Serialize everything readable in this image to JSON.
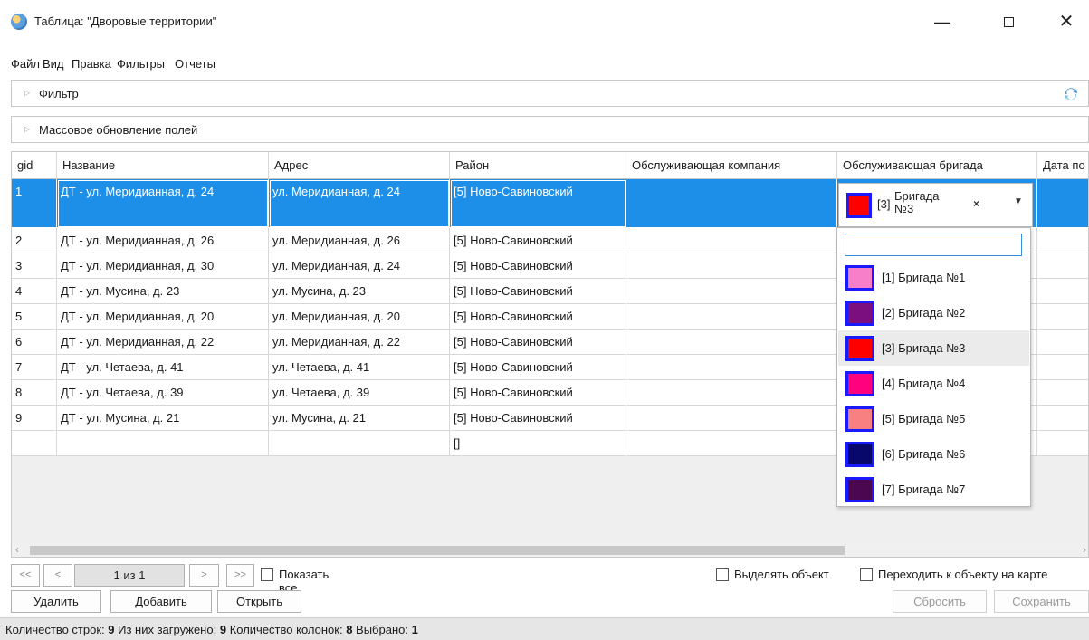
{
  "window": {
    "title": "Таблица: \"Дворовые территории\"",
    "minimize_glyph": "—",
    "close_glyph": "✕"
  },
  "menu": [
    "Файл",
    "Вид",
    "Правка",
    "Фильтры",
    "Отчеты"
  ],
  "panels": {
    "filter_label": "Фильтр",
    "mass_update_label": "Массовое обновление полей"
  },
  "grid": {
    "columns": [
      "gid",
      "Название",
      "Адрес",
      "Район",
      "Обслуживающая компания",
      "Обслуживающая бригада",
      "Дата по"
    ],
    "rows": [
      {
        "gid": "1",
        "name": "ДТ - ул. Меридианная, д. 24",
        "address": "ул. Меридианная, д. 24",
        "district": "[5]  Ново-Савиновский",
        "selected": true
      },
      {
        "gid": "2",
        "name": "ДТ - ул. Меридианная, д. 26",
        "address": "ул. Меридианная, д. 26",
        "district": "[5]  Ново-Савиновский"
      },
      {
        "gid": "3",
        "name": "ДТ - ул. Меридианная, д. 30",
        "address": "ул. Меридианная, д. 24",
        "district": "[5]  Ново-Савиновский"
      },
      {
        "gid": "4",
        "name": "ДТ - ул. Мусина, д. 23",
        "address": "ул. Мусина, д. 23",
        "district": "[5]  Ново-Савиновский"
      },
      {
        "gid": "5",
        "name": "ДТ - ул. Меридианная, д. 20",
        "address": "ул. Меридианная, д. 20",
        "district": "[5]  Ново-Савиновский"
      },
      {
        "gid": "6",
        "name": "ДТ - ул. Меридианная, д. 22",
        "address": "ул. Меридианная, д. 22",
        "district": "[5]  Ново-Савиновский"
      },
      {
        "gid": "7",
        "name": "ДТ - ул. Четаева, д. 41",
        "address": "ул. Четаева, д. 41",
        "district": "[5]  Ново-Савиновский"
      },
      {
        "gid": "8",
        "name": "ДТ - ул. Четаева, д. 39",
        "address": "ул. Четаева, д. 39",
        "district": "[5]  Ново-Савиновский"
      },
      {
        "gid": "9",
        "name": "ДТ - ул. Мусина, д. 21",
        "address": "ул. Мусина, д. 21",
        "district": "[5]  Ново-Савиновский"
      }
    ],
    "new_row_district": "[]",
    "selection_color": "#1e8fe8"
  },
  "brigade_combo": {
    "selected_number": "[3]",
    "selected_name": "Бригада №3",
    "selected_color": "#ff0000",
    "clear_glyph": "×",
    "chevron_glyph": "⌄",
    "search_value": "",
    "options": [
      {
        "label": "[1] Бригада №1",
        "color": "#f77fc9"
      },
      {
        "label": "[2] Бригада №2",
        "color": "#7b0f80"
      },
      {
        "label": "[3] Бригада №3",
        "color": "#ff0000",
        "hover": true
      },
      {
        "label": "[4] Бригада №4",
        "color": "#ff007f"
      },
      {
        "label": "[5] Бригада №5",
        "color": "#f88080"
      },
      {
        "label": "[6] Бригада №6",
        "color": "#08086a"
      },
      {
        "label": "[7] Бригада №7",
        "color": "#4b0850"
      }
    ],
    "swatch_border_color": "#1a1aff"
  },
  "pager": {
    "first": "<<",
    "prev": "<",
    "info": "1 из 1",
    "next": ">",
    "last": ">>",
    "show_all_label": "Показать все",
    "select_object_label": "Выделять объект",
    "goto_object_label": "Переходить к объекту на карте"
  },
  "actions": {
    "delete": "Удалить",
    "add": "Добавить",
    "open": "Открыть",
    "reset": "Сбросить",
    "save": "Сохранить"
  },
  "status": {
    "rows_label": "Количество строк:",
    "rows_value": "9",
    "loaded_label": "Из них загружено:",
    "loaded_value": "9",
    "cols_label": "Количество колонок:",
    "cols_value": "8",
    "selected_label": "Выбрано:",
    "selected_value": "1"
  }
}
